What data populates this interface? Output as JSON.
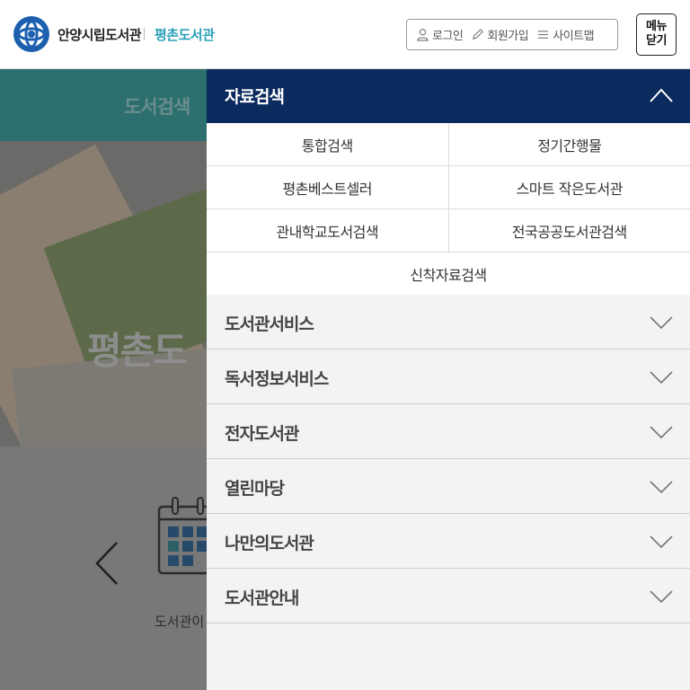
{
  "header": {
    "site_name": "안양시립도서관",
    "branch_name": "평촌도서관",
    "login": "로그인",
    "signup": "회원가입",
    "sitemap": "사이트맵",
    "menu_close_line1": "메뉴",
    "menu_close_line2": "닫기",
    "brand_color": "#2aa0b8"
  },
  "background": {
    "tab_label": "도서검색",
    "hero_text": "평촌도",
    "caption": "도서관이"
  },
  "menu": {
    "active_section": "자료검색",
    "accent_color": "#0b2a5e",
    "sub_items": [
      "통합검색",
      "정기간행물",
      "평촌베스트셀러",
      "스마트 작은도서관",
      "관내학교도서검색",
      "전국공공도서관검색",
      "신착자료검색"
    ],
    "sections": [
      "도서관서비스",
      "독서정보서비스",
      "전자도서관",
      "열린마당",
      "나만의도서관",
      "도서관안내"
    ]
  }
}
